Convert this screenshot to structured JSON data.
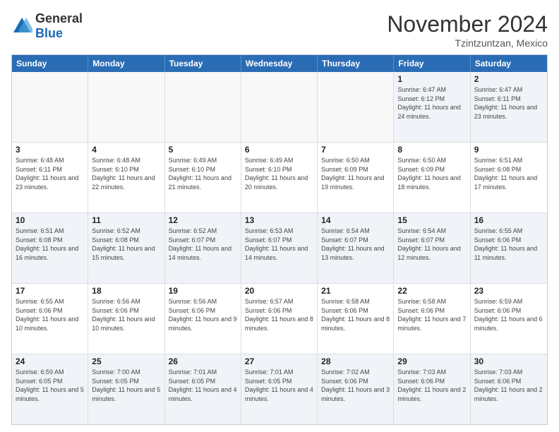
{
  "header": {
    "logo": {
      "general": "General",
      "blue": "Blue"
    },
    "title": "November 2024",
    "location": "Tzintzuntzan, Mexico"
  },
  "weekdays": [
    "Sunday",
    "Monday",
    "Tuesday",
    "Wednesday",
    "Thursday",
    "Friday",
    "Saturday"
  ],
  "rows": [
    [
      {
        "day": "",
        "text": ""
      },
      {
        "day": "",
        "text": ""
      },
      {
        "day": "",
        "text": ""
      },
      {
        "day": "",
        "text": ""
      },
      {
        "day": "",
        "text": ""
      },
      {
        "day": "1",
        "text": "Sunrise: 6:47 AM\nSunset: 6:12 PM\nDaylight: 11 hours and 24 minutes."
      },
      {
        "day": "2",
        "text": "Sunrise: 6:47 AM\nSunset: 6:11 PM\nDaylight: 11 hours and 23 minutes."
      }
    ],
    [
      {
        "day": "3",
        "text": "Sunrise: 6:48 AM\nSunset: 6:11 PM\nDaylight: 11 hours and 23 minutes."
      },
      {
        "day": "4",
        "text": "Sunrise: 6:48 AM\nSunset: 6:10 PM\nDaylight: 11 hours and 22 minutes."
      },
      {
        "day": "5",
        "text": "Sunrise: 6:49 AM\nSunset: 6:10 PM\nDaylight: 11 hours and 21 minutes."
      },
      {
        "day": "6",
        "text": "Sunrise: 6:49 AM\nSunset: 6:10 PM\nDaylight: 11 hours and 20 minutes."
      },
      {
        "day": "7",
        "text": "Sunrise: 6:50 AM\nSunset: 6:09 PM\nDaylight: 11 hours and 19 minutes."
      },
      {
        "day": "8",
        "text": "Sunrise: 6:50 AM\nSunset: 6:09 PM\nDaylight: 11 hours and 18 minutes."
      },
      {
        "day": "9",
        "text": "Sunrise: 6:51 AM\nSunset: 6:08 PM\nDaylight: 11 hours and 17 minutes."
      }
    ],
    [
      {
        "day": "10",
        "text": "Sunrise: 6:51 AM\nSunset: 6:08 PM\nDaylight: 11 hours and 16 minutes."
      },
      {
        "day": "11",
        "text": "Sunrise: 6:52 AM\nSunset: 6:08 PM\nDaylight: 11 hours and 15 minutes."
      },
      {
        "day": "12",
        "text": "Sunrise: 6:52 AM\nSunset: 6:07 PM\nDaylight: 11 hours and 14 minutes."
      },
      {
        "day": "13",
        "text": "Sunrise: 6:53 AM\nSunset: 6:07 PM\nDaylight: 11 hours and 14 minutes."
      },
      {
        "day": "14",
        "text": "Sunrise: 6:54 AM\nSunset: 6:07 PM\nDaylight: 11 hours and 13 minutes."
      },
      {
        "day": "15",
        "text": "Sunrise: 6:54 AM\nSunset: 6:07 PM\nDaylight: 11 hours and 12 minutes."
      },
      {
        "day": "16",
        "text": "Sunrise: 6:55 AM\nSunset: 6:06 PM\nDaylight: 11 hours and 11 minutes."
      }
    ],
    [
      {
        "day": "17",
        "text": "Sunrise: 6:55 AM\nSunset: 6:06 PM\nDaylight: 11 hours and 10 minutes."
      },
      {
        "day": "18",
        "text": "Sunrise: 6:56 AM\nSunset: 6:06 PM\nDaylight: 11 hours and 10 minutes."
      },
      {
        "day": "19",
        "text": "Sunrise: 6:56 AM\nSunset: 6:06 PM\nDaylight: 11 hours and 9 minutes."
      },
      {
        "day": "20",
        "text": "Sunrise: 6:57 AM\nSunset: 6:06 PM\nDaylight: 11 hours and 8 minutes."
      },
      {
        "day": "21",
        "text": "Sunrise: 6:58 AM\nSunset: 6:06 PM\nDaylight: 11 hours and 8 minutes."
      },
      {
        "day": "22",
        "text": "Sunrise: 6:58 AM\nSunset: 6:06 PM\nDaylight: 11 hours and 7 minutes."
      },
      {
        "day": "23",
        "text": "Sunrise: 6:59 AM\nSunset: 6:06 PM\nDaylight: 11 hours and 6 minutes."
      }
    ],
    [
      {
        "day": "24",
        "text": "Sunrise: 6:59 AM\nSunset: 6:05 PM\nDaylight: 11 hours and 5 minutes."
      },
      {
        "day": "25",
        "text": "Sunrise: 7:00 AM\nSunset: 6:05 PM\nDaylight: 11 hours and 5 minutes."
      },
      {
        "day": "26",
        "text": "Sunrise: 7:01 AM\nSunset: 6:05 PM\nDaylight: 11 hours and 4 minutes."
      },
      {
        "day": "27",
        "text": "Sunrise: 7:01 AM\nSunset: 6:05 PM\nDaylight: 11 hours and 4 minutes."
      },
      {
        "day": "28",
        "text": "Sunrise: 7:02 AM\nSunset: 6:06 PM\nDaylight: 11 hours and 3 minutes."
      },
      {
        "day": "29",
        "text": "Sunrise: 7:03 AM\nSunset: 6:06 PM\nDaylight: 11 hours and 2 minutes."
      },
      {
        "day": "30",
        "text": "Sunrise: 7:03 AM\nSunset: 6:06 PM\nDaylight: 11 hours and 2 minutes."
      }
    ]
  ]
}
